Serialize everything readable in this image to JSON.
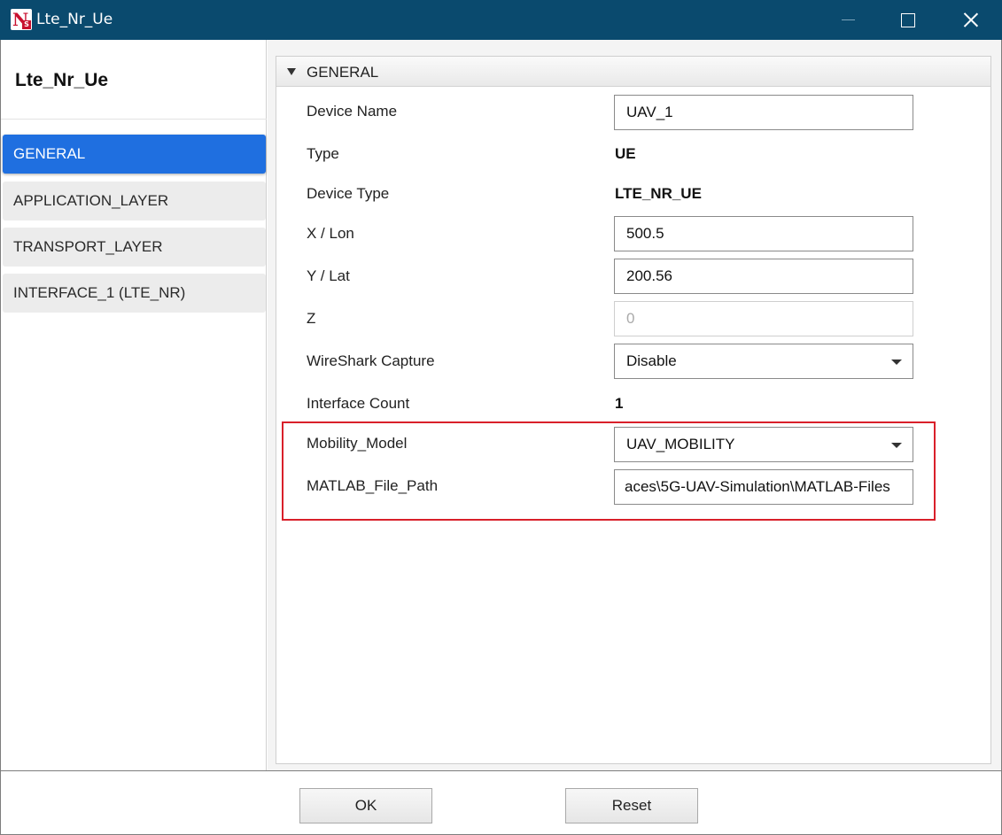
{
  "window": {
    "title": "Lte_Nr_Ue",
    "app_icon_letter": "N",
    "app_icon_badge": "S"
  },
  "sidebar": {
    "device_title": "Lte_Nr_Ue",
    "items": [
      {
        "label": "GENERAL",
        "active": true
      },
      {
        "label": "APPLICATION_LAYER",
        "active": false
      },
      {
        "label": "TRANSPORT_LAYER",
        "active": false
      },
      {
        "label": "INTERFACE_1 (LTE_NR)",
        "active": false
      }
    ]
  },
  "panel": {
    "section_title": "GENERAL",
    "fields": {
      "device_name": {
        "label": "Device Name",
        "value": "UAV_1"
      },
      "type": {
        "label": "Type",
        "value": "UE"
      },
      "device_type": {
        "label": "Device Type",
        "value": "LTE_NR_UE"
      },
      "x_lon": {
        "label": "X / Lon",
        "value": "500.5"
      },
      "y_lat": {
        "label": "Y / Lat",
        "value": "200.56"
      },
      "z": {
        "label": "Z",
        "value": "0"
      },
      "wireshark_capture": {
        "label": "WireShark Capture",
        "value": "Disable"
      },
      "interface_count": {
        "label": "Interface Count",
        "value": "1"
      },
      "mobility_model": {
        "label": "Mobility_Model",
        "value": "UAV_MOBILITY"
      },
      "matlab_file_path": {
        "label": "MATLAB_File_Path",
        "value": "aces\\5G-UAV-Simulation\\MATLAB-Files"
      }
    }
  },
  "footer": {
    "ok_label": "OK",
    "reset_label": "Reset"
  },
  "colors": {
    "titlebar": "#0a4a6e",
    "active_nav": "#1f6fe0",
    "highlight_border": "#d9202a"
  }
}
